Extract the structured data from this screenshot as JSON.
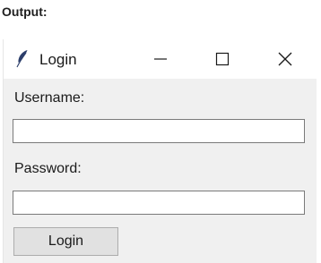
{
  "output": {
    "label": "Output:"
  },
  "window": {
    "title": "Login",
    "icon": "feather-icon",
    "controls": [
      "minimize-icon",
      "maximize-icon",
      "close-icon"
    ]
  },
  "form": {
    "username_label": "Username:",
    "username_value": "",
    "password_label": "Password:",
    "password_value": "",
    "login_label": "Login"
  }
}
